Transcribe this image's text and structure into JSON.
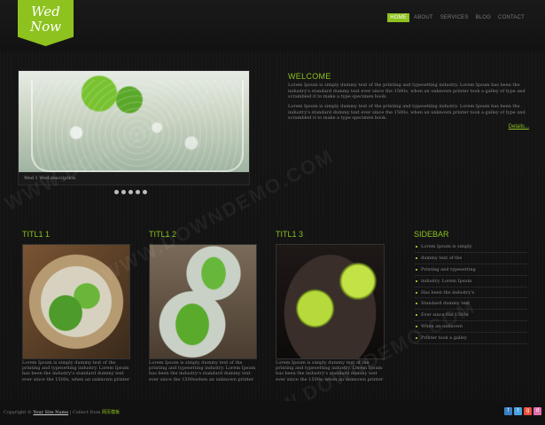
{
  "logo": {
    "line1": "Wed",
    "line2": "Now"
  },
  "nav": [
    {
      "label": "HOME",
      "active": true
    },
    {
      "label": "ABOUT",
      "active": false
    },
    {
      "label": "SERVICES",
      "active": false
    },
    {
      "label": "BLOG",
      "active": false
    },
    {
      "label": "CONTACT",
      "active": false
    }
  ],
  "slider": {
    "caption": "Wed 1 Wed description",
    "dots": 5
  },
  "welcome": {
    "title": "WELCOME",
    "p1": "Lorem Ipsum is simply dummy text of the printing and typesetting industry. Lorem Ipsum has been the industry's standard dummy text ever since the 1500s, when an unknown printer took a galley of type and scrambled it to make a type specimen book.",
    "p2": "Lorem Ipsum is simply dummy text of the printing and typesetting industry. Lorem Ipsum has been the industry's standard dummy text ever since the 1500s, when an unknown printer took a galley of type and scrambled it to make a type specimen book.",
    "details": "Details..."
  },
  "cards": [
    {
      "title": "TITL1 1",
      "text": "Lorem Ipsum is simply dummy text of the printing and typesetting industry. Lorem Ipsum has been the industry's standard dummy text ever since the 1500s, when an unknown printer"
    },
    {
      "title": "TITL1 2",
      "text": "Lorem Ipsum is simply dummy text of the printing and typesetting industry. Lorem Ipsum has been the industry's standard dummy text ever since the 1500swhen an unknown printer"
    },
    {
      "title": "TITL1 3",
      "text": "Lorem Ipsum is simply dummy text of the printing and typesetting industry. Lorem Ipsum has been the industry's standard dummy text ever since the 1500s, when an unknown printer"
    }
  ],
  "sidebar": {
    "title": "SIDEBAR",
    "items": [
      "Lorem Ipsum is simply",
      "dummy text of the",
      "Printing and typesetting",
      "industry. Lorem Ipsum",
      "Has been the industry's",
      "Standard dummy text",
      "Ever since the 1500s",
      "When an unknown",
      "Printer took a galley"
    ]
  },
  "footer": {
    "prefix": "Copyright © ",
    "site": "Your Site Name",
    "middle": " | Collect from ",
    "brand": "网页模板"
  },
  "social_colors": [
    "#3b7fc4",
    "#4aa3df",
    "#e94e3c",
    "#e36fae"
  ],
  "social_icons": [
    "facebook-icon",
    "twitter-icon",
    "googleplus-icon",
    "dribbble-icon"
  ],
  "watermark": "WWW.DOWNDEMO.COM"
}
